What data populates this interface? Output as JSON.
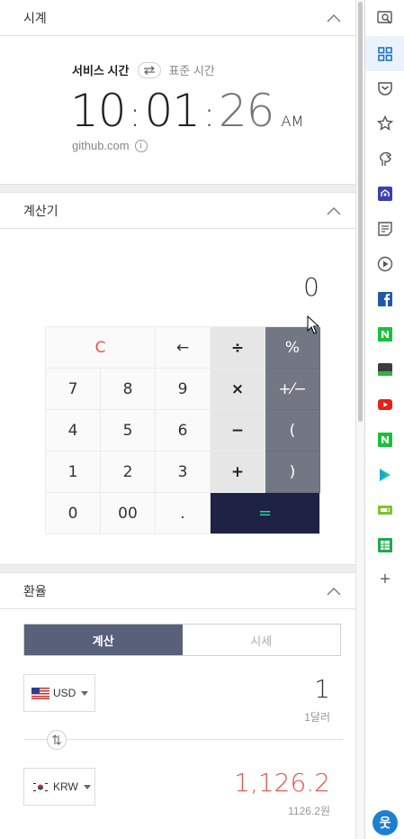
{
  "clock": {
    "title": "시계",
    "tab_service": "서비스 시간",
    "tab_standard": "표준 시간",
    "hour": "10",
    "minute": "01",
    "second": "26",
    "ampm": "AM",
    "source": "github.com",
    "info": "i"
  },
  "calculator": {
    "title": "계산기",
    "display": "0",
    "keys": {
      "clear": "C",
      "back": "←",
      "div": "÷",
      "pct": "%",
      "k7": "7",
      "k8": "8",
      "k9": "9",
      "mul": "×",
      "pm": "+⁄−",
      "k4": "4",
      "k5": "5",
      "k6": "6",
      "minus": "−",
      "lparen": "(",
      "k1": "1",
      "k2": "2",
      "k3": "3",
      "plus": "+",
      "rparen": ")",
      "k0": "0",
      "k00": "00",
      "dot": ".",
      "eq": "="
    }
  },
  "exchange": {
    "title": "환율",
    "tab_calc": "계산",
    "tab_rate": "시세",
    "from_currency": "USD",
    "from_amount": "1",
    "from_label": "1달러",
    "to_currency": "KRW",
    "to_amount": "1,126.2",
    "to_label": "1126.2원"
  },
  "colors": {
    "accent_red": "#e5534b",
    "accent_green": "#2fd5a0",
    "dark_navy": "#1e2346",
    "seg_active": "#59607a"
  },
  "right_bar": {
    "icons": [
      "search-window-icon",
      "widgets-grid-icon",
      "pocket-icon",
      "star-icon",
      "dino-icon",
      "vpn-icon",
      "memo-icon",
      "play-circle-icon",
      "facebook-icon",
      "naver-icon",
      "webtoon-icon",
      "youtube-icon",
      "naver-blog-icon",
      "play-store-icon",
      "ticket-icon",
      "sheet-icon",
      "add-icon",
      "profile-icon"
    ],
    "add": "+",
    "profile": "웃"
  }
}
